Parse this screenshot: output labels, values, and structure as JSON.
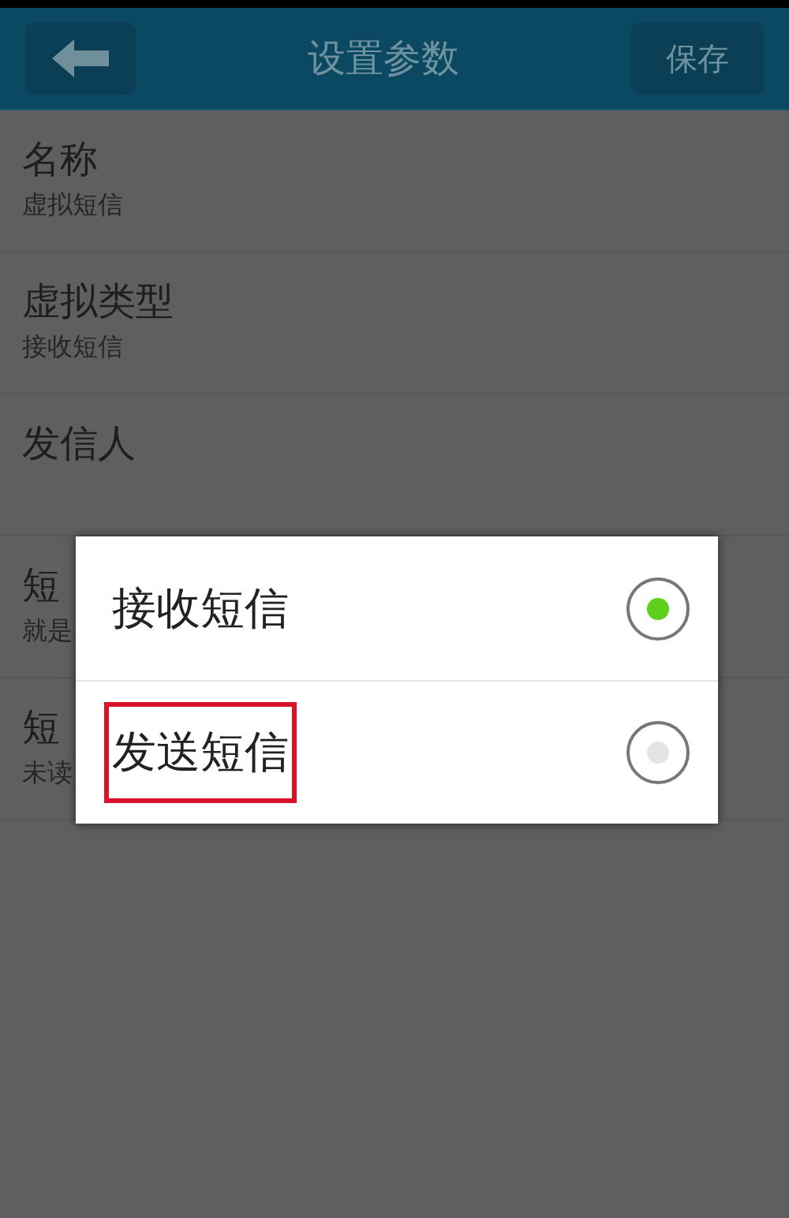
{
  "header": {
    "title": "设置参数",
    "save_button": "保存"
  },
  "settings": [
    {
      "label": "名称",
      "value": "虚拟短信"
    },
    {
      "label": "虚拟类型",
      "value": "接收短信"
    },
    {
      "label": "发信人"
    },
    {
      "label": "短",
      "value": "就是"
    },
    {
      "label": "短",
      "value": "未读"
    }
  ],
  "dialog": {
    "options": [
      {
        "label": "接收短信",
        "selected": true,
        "highlighted": false
      },
      {
        "label": "发送短信",
        "selected": false,
        "highlighted": true
      }
    ]
  }
}
